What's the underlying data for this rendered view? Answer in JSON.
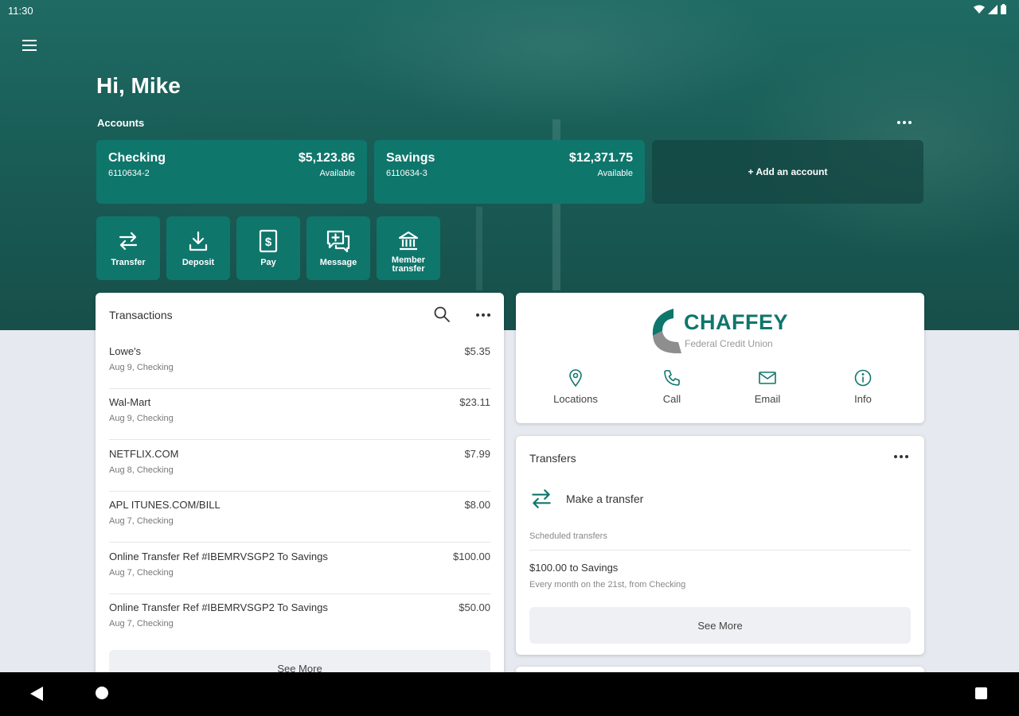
{
  "status": {
    "time": "11:30"
  },
  "greeting": "Hi, Mike",
  "accounts": {
    "label": "Accounts",
    "items": [
      {
        "name": "Checking",
        "number": "6110634-2",
        "balance": "$5,123.86",
        "balance_label": "Available"
      },
      {
        "name": "Savings",
        "number": "6110634-3",
        "balance": "$12,371.75",
        "balance_label": "Available"
      }
    ],
    "add_label": "+ Add an account"
  },
  "actions": [
    {
      "label": "Transfer",
      "icon": "transfer-icon"
    },
    {
      "label": "Deposit",
      "icon": "deposit-icon"
    },
    {
      "label": "Pay",
      "icon": "pay-icon"
    },
    {
      "label": "Message",
      "icon": "message-icon"
    },
    {
      "label": "Member transfer",
      "icon": "bank-icon"
    }
  ],
  "transactions": {
    "title": "Transactions",
    "rows": [
      {
        "desc": "Lowe's",
        "amount": "$5.35",
        "sub": "Aug 9, Checking"
      },
      {
        "desc": "Wal-Mart",
        "amount": "$23.11",
        "sub": "Aug 9, Checking"
      },
      {
        "desc": "NETFLIX.COM",
        "amount": "$7.99",
        "sub": "Aug 8, Checking"
      },
      {
        "desc": "APL ITUNES.COM/BILL",
        "amount": "$8.00",
        "sub": "Aug 7, Checking"
      },
      {
        "desc": "Online Transfer Ref #IBEMRVSGP2 To Savings",
        "amount": "$100.00",
        "sub": "Aug 7, Checking"
      },
      {
        "desc": "Online Transfer Ref #IBEMRVSGP2 To Savings",
        "amount": "$50.00",
        "sub": "Aug 7, Checking"
      }
    ],
    "see_more": "See More"
  },
  "brand": {
    "name": "CHAFFEY",
    "subtitle": "Federal Credit Union",
    "contacts": [
      {
        "label": "Locations",
        "icon": "location-pin-icon"
      },
      {
        "label": "Call",
        "icon": "phone-icon"
      },
      {
        "label": "Email",
        "icon": "email-icon"
      },
      {
        "label": "Info",
        "icon": "info-icon"
      }
    ]
  },
  "transfers": {
    "title": "Transfers",
    "make_label": "Make a transfer",
    "scheduled_label": "Scheduled transfers",
    "scheduled": [
      {
        "title": "$100.00 to Savings",
        "sub": "Every month on the 21st, from Checking"
      }
    ],
    "see_more": "See More"
  },
  "colors": {
    "brand_teal": "#0f766c",
    "hero_bg": "#1a5e58",
    "page_bg": "#e6e9ef"
  }
}
